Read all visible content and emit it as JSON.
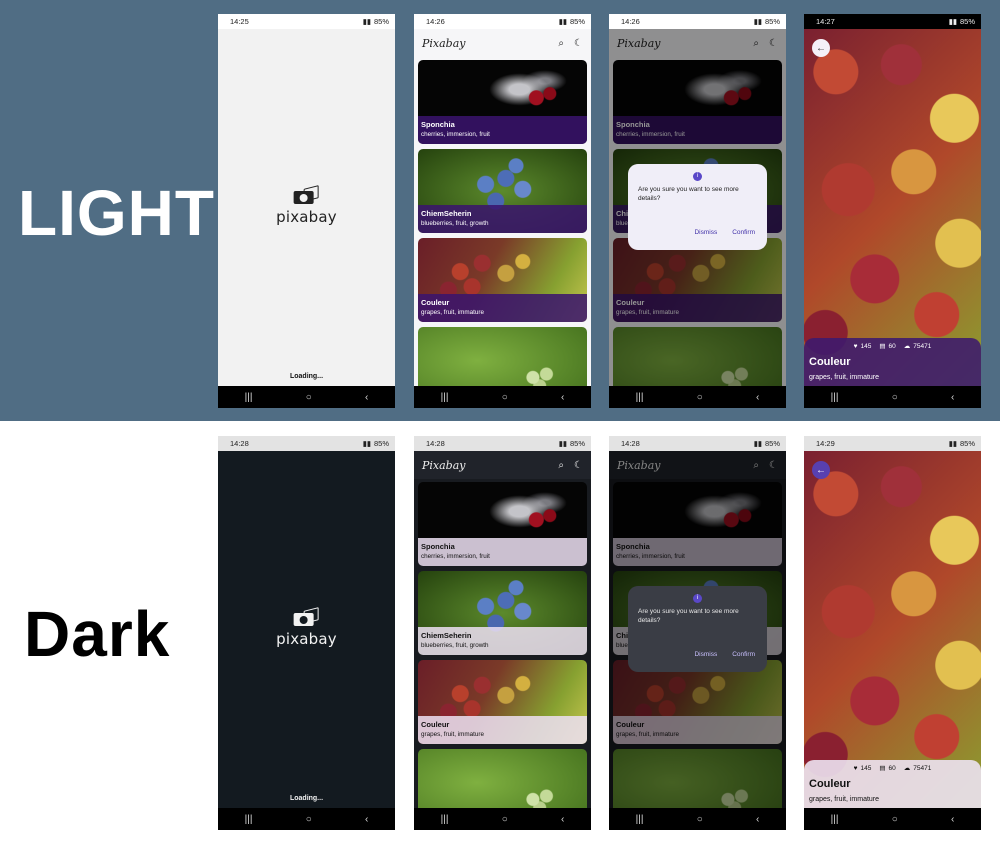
{
  "labels": {
    "light": "LIGHT",
    "dark": "Dark"
  },
  "status_times": {
    "light": [
      "14:25",
      "14:26",
      "14:26",
      "14:27"
    ],
    "dark": [
      "14:28",
      "14:28",
      "14:28",
      "14:29"
    ]
  },
  "status": {
    "battery": "85%"
  },
  "splash": {
    "logo": "pixabay",
    "loading": "Loading..."
  },
  "app": {
    "title": "Pixabay"
  },
  "cards": [
    {
      "title": "Sponchia",
      "tags": "cherries, immersion, fruit"
    },
    {
      "title": "ChiemSeherin",
      "tags": "blueberries, fruit, growth"
    },
    {
      "title": "Couleur",
      "tags": "grapes, fruit, immature"
    }
  ],
  "dialog": {
    "text": "Are you sure you want to see more details?",
    "dismiss": "Dismiss",
    "confirm": "Confirm"
  },
  "detail": {
    "likes": "145",
    "comments": "60",
    "downloads": "75471",
    "title": "Couleur",
    "tags": "grapes, fruit, immature"
  },
  "icons": {
    "search": "search-icon",
    "theme": "moon-icon",
    "back": "back-arrow-icon",
    "nav_recents": "recents-icon",
    "nav_home": "home-icon",
    "nav_back": "nav-back-icon"
  }
}
